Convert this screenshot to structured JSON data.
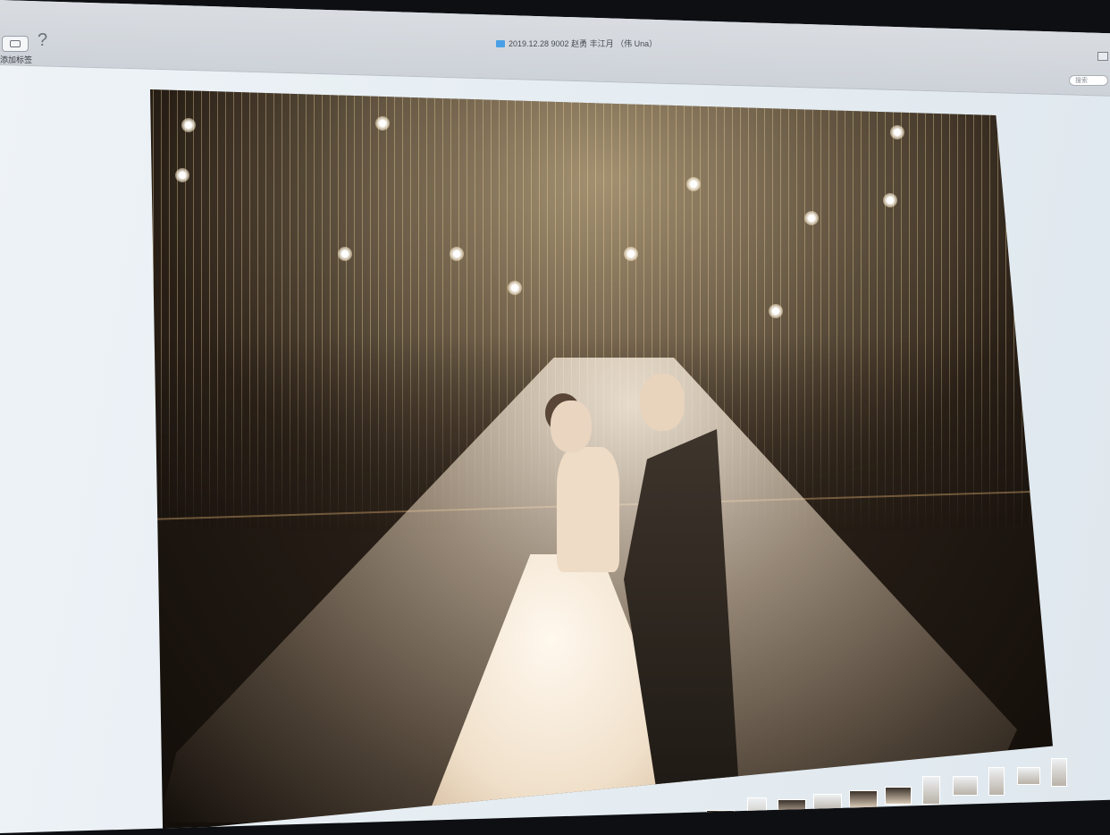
{
  "window": {
    "title": "2019.12.28 9002 赵勇 丰江月 （伟 Una）",
    "tab_label": "添加标签",
    "help_icon": "question-icon",
    "search_placeholder": "搜索"
  },
  "viewer": {
    "photo_subject": "",
    "thumbnail_count": 17
  },
  "colors": {
    "folder_accent": "#4aa0e6",
    "chrome": "#d9dde2",
    "background": "#e7eef3"
  }
}
